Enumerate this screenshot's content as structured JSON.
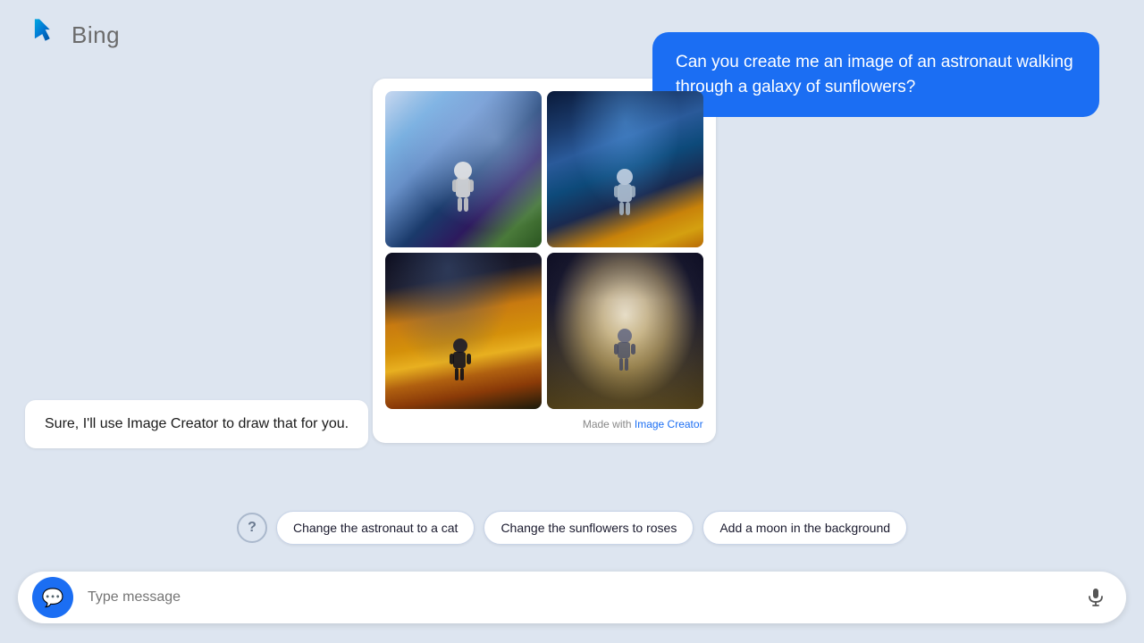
{
  "header": {
    "logo_text": "Bing"
  },
  "user_message": {
    "text": "Can you create me an image of an astronaut walking through a galaxy of sunflowers?"
  },
  "ai_response": {
    "text": "Sure, I'll use Image Creator to draw that for you."
  },
  "image_grid": {
    "made_with_prefix": "Made with ",
    "made_with_link": "Image Creator"
  },
  "suggestions": {
    "help_label": "?",
    "chips": [
      {
        "label": "Change the astronaut to a cat",
        "id": "chip-cat"
      },
      {
        "label": "Change the sunflowers to roses",
        "id": "chip-roses"
      },
      {
        "label": "Add a moon in the background",
        "id": "chip-moon"
      }
    ]
  },
  "input_bar": {
    "placeholder": "Type message"
  }
}
